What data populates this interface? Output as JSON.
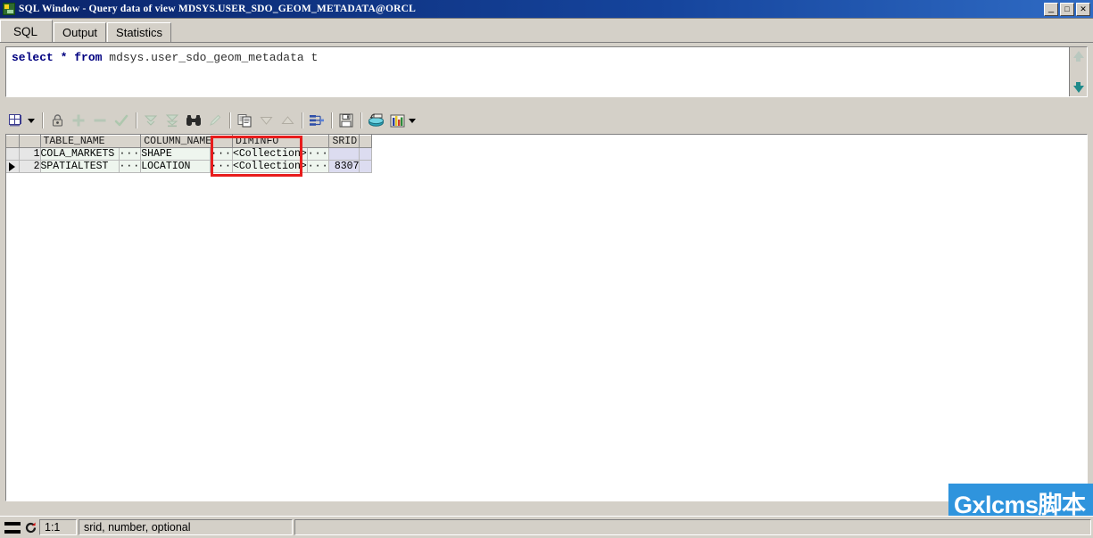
{
  "window": {
    "title": "SQL Window - Query data of view MDSYS.USER_SDO_GEOM_METADATA@ORCL",
    "app_icon": "sql-window-icon",
    "controls": {
      "minimize": "_",
      "maximize": "□",
      "close": "✕"
    }
  },
  "tabs": [
    {
      "label": "SQL",
      "active": true
    },
    {
      "label": "Output",
      "active": false
    },
    {
      "label": "Statistics",
      "active": false
    }
  ],
  "editor": {
    "sql_keyword_1": "select",
    "sql_star": "*",
    "sql_keyword_2": "from",
    "sql_rest": " mdsys.user_sdo_geom_metadata t",
    "full_text": "select * from mdsys.user_sdo_geom_metadata t",
    "scroll_up_icon": "arrow-up-icon",
    "scroll_down_icon": "arrow-down-icon"
  },
  "toolbar": {
    "items": [
      {
        "name": "grid-layout-button",
        "icon": "grid-icon",
        "dropdown": true,
        "enabled": true
      },
      {
        "name": "lock-record-button",
        "icon": "lock-icon",
        "enabled": true
      },
      {
        "name": "insert-record-button",
        "icon": "plus-icon",
        "enabled": false
      },
      {
        "name": "delete-record-button",
        "icon": "minus-icon",
        "enabled": false
      },
      {
        "name": "post-changes-button",
        "icon": "check-icon",
        "enabled": false
      },
      {
        "name": "fetch-next-page-button",
        "icon": "double-chevron-down-icon",
        "enabled": false
      },
      {
        "name": "fetch-last-page-button",
        "icon": "chevron-down-bar-icon",
        "enabled": false
      },
      {
        "name": "find-button",
        "icon": "binoculars-icon",
        "enabled": true
      },
      {
        "name": "edit-data-button",
        "icon": "pencil-icon",
        "enabled": false
      },
      {
        "name": "copy-to-clipboard-button",
        "icon": "copy-pages-icon",
        "enabled": true
      },
      {
        "name": "sort-descending-button",
        "icon": "triangle-down-icon",
        "enabled": false
      },
      {
        "name": "sort-ascending-button",
        "icon": "triangle-up-icon",
        "enabled": false
      },
      {
        "name": "explain-plan-button",
        "icon": "plan-tree-icon",
        "enabled": true
      },
      {
        "name": "save-button",
        "icon": "floppy-disk-icon",
        "enabled": true
      },
      {
        "name": "export-database-button",
        "icon": "database-export-icon",
        "enabled": true
      },
      {
        "name": "chart-button",
        "icon": "bar-chart-icon",
        "dropdown": true,
        "enabled": true
      }
    ]
  },
  "grid": {
    "columns": [
      "TABLE_NAME",
      "COLUMN_NAME",
      "DIMINFO",
      "SRID"
    ],
    "rows": [
      {
        "row_number": "1",
        "current": false,
        "TABLE_NAME": "COLA_MARKETS",
        "COLUMN_NAME": "SHAPE",
        "DIMINFO": "<Collection>",
        "SRID": ""
      },
      {
        "row_number": "2",
        "current": true,
        "TABLE_NAME": "SPATIALTEST",
        "COLUMN_NAME": "LOCATION",
        "DIMINFO": "<Collection>",
        "SRID": "8307"
      }
    ],
    "ellipsis": "···",
    "row_indicator_icon": "current-row-arrow-icon"
  },
  "annotation": {
    "shape": "rectangle",
    "color": "#e81c1c",
    "highlights_column": "DIMINFO"
  },
  "statusbar": {
    "menu_icon": "list-lines-icon",
    "refresh_icon": "refresh-icon",
    "position": "1:1",
    "message": "srid, number, optional"
  },
  "watermark": {
    "text": "Gxlcms脚本",
    "background": "#2f94dd",
    "color": "#ffffff"
  },
  "colors": {
    "title_gradient_start": "#0a246a",
    "title_gradient_end": "#2f6bc4",
    "window_face": "#d4d0c8",
    "grid_cell": "#eef5ee",
    "grid_selected_col": "#dcdcf0",
    "keyword": "#000080",
    "annotation_red": "#e81c1c"
  }
}
